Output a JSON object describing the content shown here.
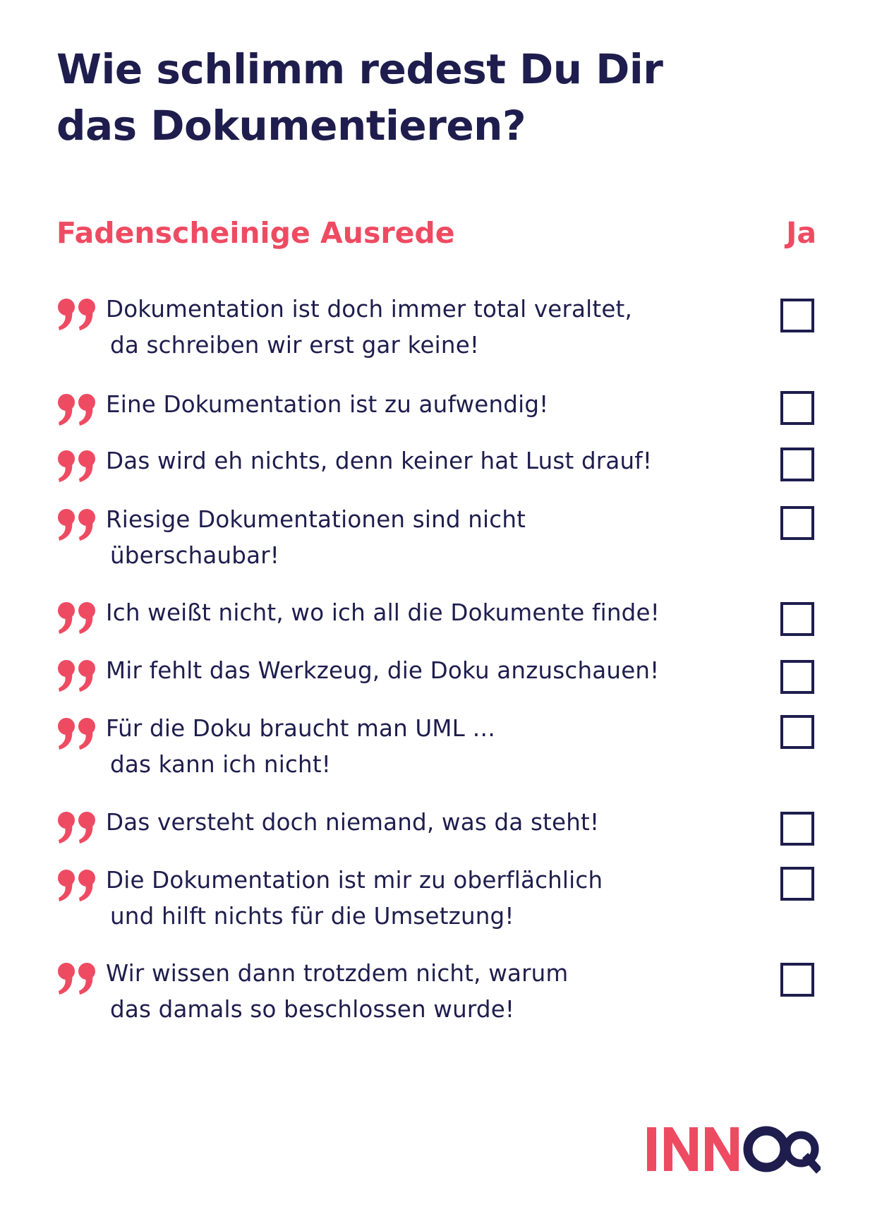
{
  "title": {
    "line1": "Wie schlimm redest Du Dir",
    "line2": "das Dokumentieren?"
  },
  "columns": {
    "left": "Fadenscheinige Ausrede",
    "right": "Ja"
  },
  "items": [
    {
      "line1": "Dokumentation ist doch immer total veraltet,",
      "line2": "da schreiben wir erst gar keine!",
      "checked": false
    },
    {
      "line1": "Eine Dokumentation ist zu aufwendig!",
      "checked": false
    },
    {
      "line1": "Das wird eh nichts, denn keiner hat Lust drauf!",
      "checked": false
    },
    {
      "line1": "Riesige Dokumentationen sind nicht",
      "line2": "überschaubar!",
      "checked": false
    },
    {
      "line1": "Ich weißt nicht, wo ich all die Dokumente finde!",
      "checked": false
    },
    {
      "line1": "Mir fehlt das Werkzeug, die Doku anzuschauen!",
      "checked": false
    },
    {
      "line1": "Für die Doku braucht man UML …",
      "line2": "das kann ich nicht!",
      "checked": false
    },
    {
      "line1": "Das versteht doch niemand, was da steht!",
      "checked": false
    },
    {
      "line1": "Die Dokumentation ist mir zu oberflächlich",
      "line2": "und hilft nichts für die Umsetzung!",
      "checked": false
    },
    {
      "line1": "Wir wissen dann trotzdem nicht, warum",
      "line2": "das damals so beschlossen wurde!",
      "checked": false
    }
  ],
  "logo": {
    "text": "INNOQ"
  },
  "colors": {
    "accent": "#ee4b62",
    "text": "#1e1d4d",
    "background": "#ffffff"
  },
  "icons": {
    "quote": "closing-quote-icon",
    "checkbox": "empty-checkbox"
  }
}
